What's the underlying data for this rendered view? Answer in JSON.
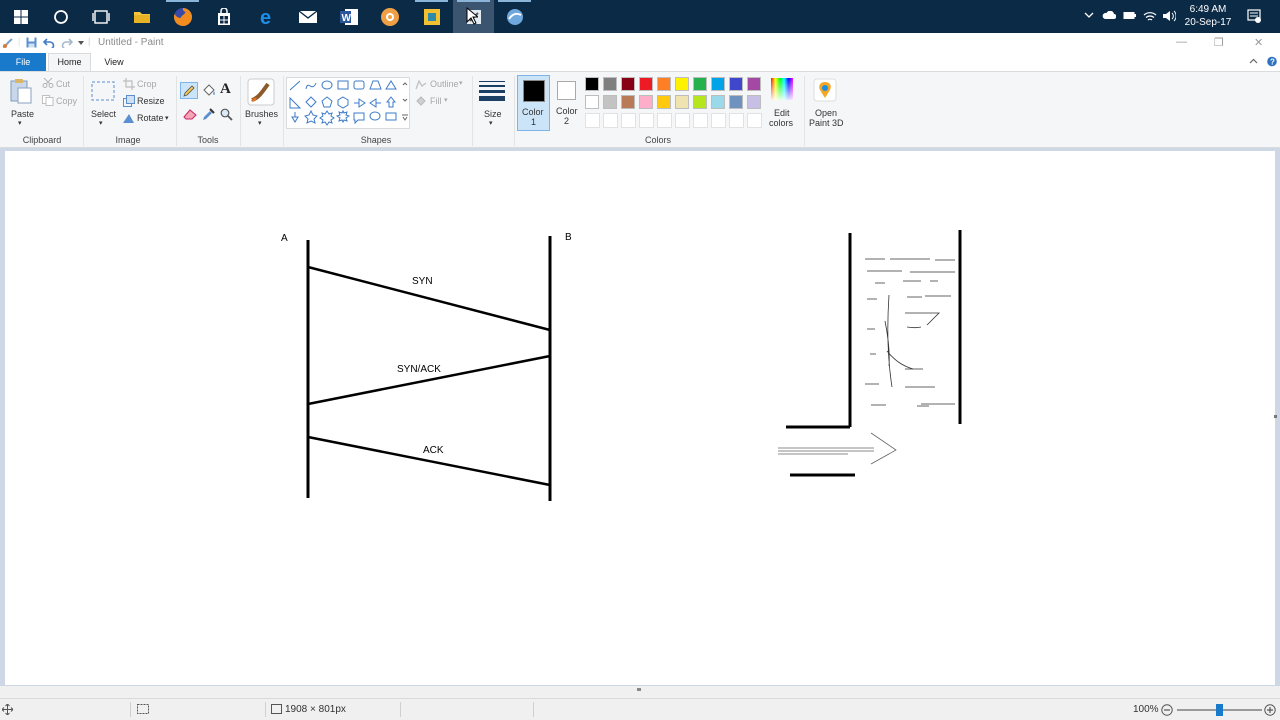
{
  "taskbar": {
    "pinned_icons": [
      "windows-start-icon",
      "cortana-search-icon",
      "task-view-icon",
      "file-explorer-icon",
      "firefox-icon",
      "store-icon",
      "edge-icon",
      "mail-icon",
      "word-icon",
      "app-orange-icon",
      "app-yellow-icon",
      "paint-icon",
      "app-blue-icon"
    ],
    "clock_time": "6:49 AM",
    "clock_date": "20-Sep-17"
  },
  "window": {
    "title": "Untitled - Paint"
  },
  "ribbon": {
    "tabs": {
      "file": "File",
      "home": "Home",
      "view": "View"
    },
    "clipboard": {
      "paste": "Paste",
      "cut": "Cut",
      "copy": "Copy",
      "group": "Clipboard"
    },
    "image": {
      "select": "Select",
      "crop": "Crop",
      "resize": "Resize",
      "rotate": "Rotate",
      "group": "Image"
    },
    "tools": {
      "group": "Tools"
    },
    "brushes": {
      "label": "Brushes"
    },
    "shapes": {
      "outline": "Outline",
      "fill": "Fill",
      "group": "Shapes"
    },
    "size": {
      "label": "Size"
    },
    "colors": {
      "color1": "Color\n1",
      "color1_line1": "Color",
      "color1_line2": "1",
      "color2_line1": "Color",
      "color2_line2": "2",
      "edit_colors_line1": "Edit",
      "edit_colors_line2": "colors",
      "group": "Colors",
      "color1_value": "#000000",
      "color2_value": "#ffffff",
      "palette_row1": [
        "#000000",
        "#7f7f7f",
        "#880015",
        "#ed1c24",
        "#ff7f27",
        "#fff200",
        "#22b14c",
        "#00a2e8",
        "#3f48cc",
        "#a349a4"
      ],
      "palette_row2": [
        "#ffffff",
        "#c3c3c3",
        "#b97a57",
        "#ffaec9",
        "#ffc90e",
        "#efe4b0",
        "#b5e61d",
        "#99d9ea",
        "#7092be",
        "#c8bfe7"
      ]
    },
    "paint3d": {
      "line1": "Open",
      "line2": "Paint 3D"
    }
  },
  "drawing": {
    "label_a": "A",
    "label_b": "B",
    "syn": "SYN",
    "synack": "SYN/ACK",
    "ack": "ACK"
  },
  "status": {
    "canvas_size": "1908 × 801px",
    "zoom": "100%",
    "zoom_slider_fraction": 0.5
  }
}
